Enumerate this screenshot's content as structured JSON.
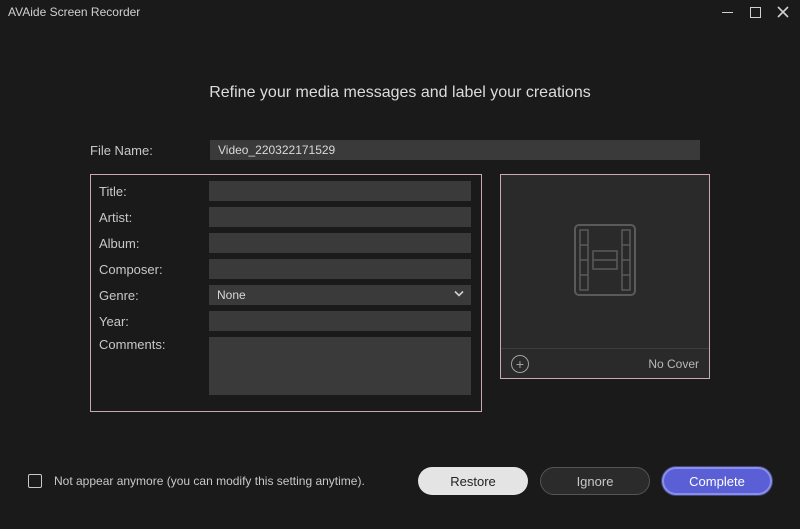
{
  "window": {
    "title": "AVAide Screen Recorder"
  },
  "heading": "Refine your media messages and label your creations",
  "labels": {
    "file_name": "File Name:",
    "title": "Title:",
    "artist": "Artist:",
    "album": "Album:",
    "composer": "Composer:",
    "genre": "Genre:",
    "year": "Year:",
    "comments": "Comments:"
  },
  "values": {
    "file_name": "Video_220322171529",
    "title": "",
    "artist": "",
    "album": "",
    "composer": "",
    "genre": "None",
    "year": "",
    "comments": ""
  },
  "cover": {
    "no_cover": "No Cover"
  },
  "footer": {
    "checkbox_label": "Not appear anymore (you can modify this setting anytime).",
    "restore": "Restore",
    "ignore": "Ignore",
    "complete": "Complete"
  }
}
